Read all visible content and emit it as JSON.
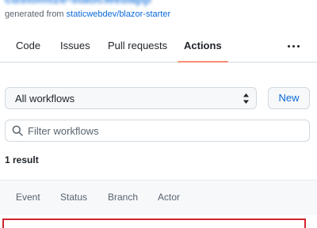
{
  "repo": {
    "title": "customize-staticwebapp",
    "generated_prefix": "generated from",
    "template_link": "staticwebdev/blazor-starter"
  },
  "tabs": [
    {
      "label": "Code"
    },
    {
      "label": "Issues"
    },
    {
      "label": "Pull requests"
    },
    {
      "label": "Actions",
      "active": true
    }
  ],
  "more_icon": "kebab-horizontal",
  "workflow_select": {
    "selected": "All workflows",
    "icon": "select-caret"
  },
  "new_button": {
    "label": "New"
  },
  "filter": {
    "placeholder": "Filter workflows",
    "value": "",
    "icon": "search"
  },
  "results": {
    "count_label": "1 result"
  },
  "table_filters": [
    "Event",
    "Status",
    "Branch",
    "Actor"
  ],
  "colors": {
    "link": "#0969da",
    "active_tab_underline": "#fd8c73",
    "highlight_border": "#d1242f",
    "muted_text": "#59636e"
  }
}
